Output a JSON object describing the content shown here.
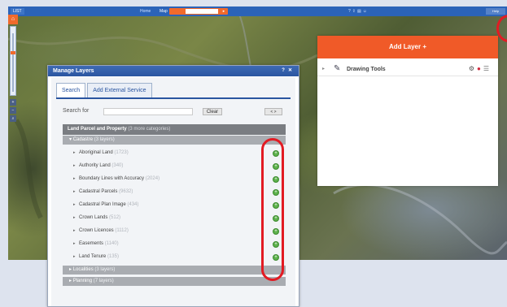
{
  "toolbar": {
    "logo": "LIST",
    "items": [
      "Home",
      "Map"
    ],
    "search_placeholder": "",
    "icons": [
      "help-icon",
      "share-icon",
      "print-icon",
      "user-icon"
    ],
    "right_label": "Help"
  },
  "add_layer_panel": {
    "title": "Add Layer +",
    "rows": [
      {
        "label": "Drawing Tools",
        "icons": [
          "settings-icon",
          "remove-icon",
          "menu-icon"
        ]
      }
    ]
  },
  "manage_layers": {
    "title": "Manage Layers",
    "header_icons": [
      "help-icon",
      "close-icon"
    ],
    "tabs": [
      {
        "label": "Search",
        "active": true
      },
      {
        "label": "Add External Service",
        "active": false
      }
    ],
    "search": {
      "label": "Search for",
      "value": "",
      "clear_label": "Clear",
      "pager_label": "< >"
    },
    "category": {
      "title": "Land Parcel and Property",
      "subtitle": "(3 more categories)"
    },
    "subcategories": [
      {
        "title": "Cadastre",
        "count": "(3 layers)"
      },
      {
        "title": "Localities",
        "count": "(3 layers)"
      },
      {
        "title": "Planning",
        "count": "(7 layers)"
      }
    ],
    "layers": [
      {
        "name": "Aboriginal Land",
        "count": "(1723)"
      },
      {
        "name": "Authority Land",
        "count": "(340)"
      },
      {
        "name": "Boundary Lines with Accuracy",
        "count": "(2024)"
      },
      {
        "name": "Cadastral Parcels",
        "count": "(9632)"
      },
      {
        "name": "Cadastral Plan Image",
        "count": "(434)"
      },
      {
        "name": "Crown Lands",
        "count": "(512)"
      },
      {
        "name": "Crown Licences",
        "count": "(1112)"
      },
      {
        "name": "Easements",
        "count": "(1140)"
      },
      {
        "name": "Land Tenure",
        "count": "(135)"
      }
    ]
  },
  "colors": {
    "brand_blue": "#2b63b8",
    "accent_orange": "#f05a28",
    "annotation_red": "#e21b23",
    "add_green": "#5bb04a"
  }
}
